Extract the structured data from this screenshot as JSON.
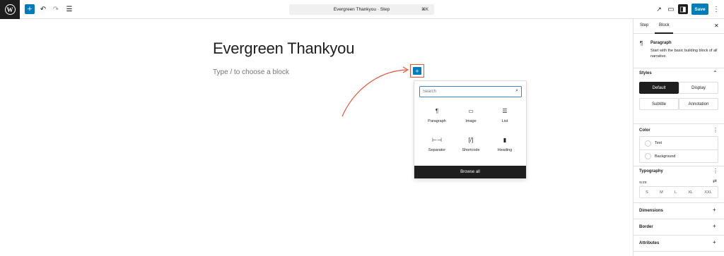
{
  "toolbar": {
    "document_title": "Evergreen Thankyou · Step",
    "shortcut": "⌘K",
    "save_label": "Save",
    "icons": [
      "wordpress-logo",
      "add-block-icon",
      "undo-icon",
      "redo-icon",
      "list-view-icon",
      "view-icon",
      "preview-icon",
      "settings-icon",
      "more-options-icon"
    ]
  },
  "editor": {
    "post_title": "Evergreen Thankyou",
    "block_placeholder": "Type / to choose a block"
  },
  "inserter": {
    "search_placeholder": "Search",
    "blocks": [
      {
        "label": "Paragraph",
        "icon": "¶"
      },
      {
        "label": "Image",
        "icon": "▭"
      },
      {
        "label": "List",
        "icon": "☰"
      },
      {
        "label": "Separator",
        "icon": "⊢⊣"
      },
      {
        "label": "Shortcode",
        "icon": "[/]"
      },
      {
        "label": "Heading",
        "icon": "▮"
      }
    ],
    "browse_all_label": "Browse all"
  },
  "sidebar": {
    "tabs": [
      "Step",
      "Block"
    ],
    "active_tab": "Block",
    "block_card": {
      "name": "Paragraph",
      "description": "Start with the basic building block of all narrative."
    },
    "styles": {
      "title": "Styles",
      "options": [
        "Default",
        "Display",
        "Subtitle",
        "Annotation"
      ],
      "active": "Default"
    },
    "color": {
      "title": "Color",
      "items": [
        "Text",
        "Background"
      ]
    },
    "typography": {
      "title": "Typography",
      "size_label": "SIZE",
      "sizes": [
        "S",
        "M",
        "L",
        "XL",
        "XXL"
      ]
    },
    "panels": [
      "Dimensions",
      "Border",
      "Attributes"
    ]
  },
  "colors": {
    "accent": "#007cba",
    "highlight": "#e2573c",
    "dark": "#1e1e1e"
  }
}
